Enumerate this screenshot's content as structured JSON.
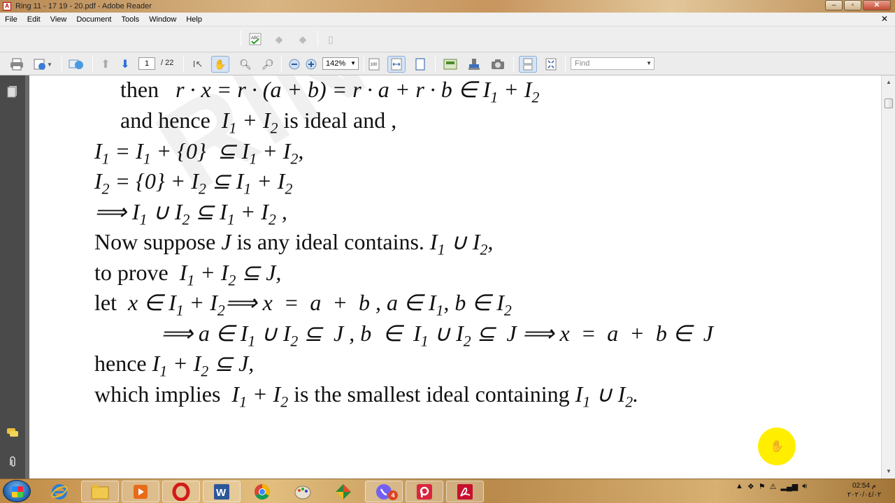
{
  "window": {
    "title": "Ring  11 - 17   19 - 20.pdf - Adobe Reader",
    "controls": [
      "–",
      "▫",
      "✕"
    ]
  },
  "menu": [
    "File",
    "Edit",
    "View",
    "Document",
    "Tools",
    "Window",
    "Help"
  ],
  "menu_close": "✕",
  "toolbar": {
    "page_current": "1",
    "page_total": "/ 22",
    "zoom": "142%",
    "find_placeholder": "Find"
  },
  "document": {
    "watermark": "RING",
    "lines": [
      {
        "parts": [
          [
            "t",
            "then   "
          ],
          [
            "m",
            "r · x = r · (a + b) = r · a + r · b ∈ I"
          ],
          [
            "s",
            "1"
          ],
          [
            "m",
            " + I"
          ],
          [
            "s",
            "2"
          ]
        ]
      },
      {
        "parts": [
          [
            "t",
            "and hence  "
          ],
          [
            "m",
            "I"
          ],
          [
            "s",
            "1"
          ],
          [
            "m",
            " + I"
          ],
          [
            "s",
            "2"
          ],
          [
            "t",
            " is ideal and ,"
          ]
        ]
      },
      {
        "parts": [
          [
            "m",
            "I"
          ],
          [
            "s",
            "1"
          ],
          [
            "m",
            " = I"
          ],
          [
            "s",
            "1"
          ],
          [
            "m",
            " + {0}  ⊆ I"
          ],
          [
            "s",
            "1"
          ],
          [
            "m",
            " + I"
          ],
          [
            "s",
            "2"
          ],
          [
            "m",
            ","
          ]
        ]
      },
      {
        "parts": [
          [
            "m",
            "I"
          ],
          [
            "s",
            "2"
          ],
          [
            "m",
            " = {0} + I"
          ],
          [
            "s",
            "2"
          ],
          [
            "m",
            " ⊆ I"
          ],
          [
            "s",
            "1"
          ],
          [
            "m",
            " + I"
          ],
          [
            "s",
            "2"
          ]
        ]
      },
      {
        "parts": [
          [
            "m",
            "⟹ I"
          ],
          [
            "s",
            "1"
          ],
          [
            "m",
            " ∪ I"
          ],
          [
            "s",
            "2"
          ],
          [
            "m",
            " ⊆ I"
          ],
          [
            "s",
            "1"
          ],
          [
            "m",
            " + I"
          ],
          [
            "s",
            "2"
          ],
          [
            "m",
            " ,"
          ]
        ]
      },
      {
        "parts": [
          [
            "t",
            "Now suppose "
          ],
          [
            "m",
            "J"
          ],
          [
            "t",
            " is any ideal contains. "
          ],
          [
            "m",
            "I"
          ],
          [
            "s",
            "1"
          ],
          [
            "m",
            " ∪ I"
          ],
          [
            "s",
            "2"
          ],
          [
            "m",
            ","
          ]
        ]
      },
      {
        "parts": [
          [
            "t",
            "to prove  "
          ],
          [
            "m",
            "I"
          ],
          [
            "s",
            "1"
          ],
          [
            "m",
            " + I"
          ],
          [
            "s",
            "2"
          ],
          [
            "m",
            " ⊆ J,"
          ]
        ]
      },
      {
        "parts": [
          [
            "t",
            "let  "
          ],
          [
            "m",
            "x ∈ I"
          ],
          [
            "s",
            "1"
          ],
          [
            "m",
            " + I"
          ],
          [
            "s",
            "2"
          ],
          [
            "m",
            "⟹ x  =  a  +  b , a ∈ I"
          ],
          [
            "s",
            "1"
          ],
          [
            "m",
            ", b ∈ I"
          ],
          [
            "s",
            "2"
          ]
        ]
      },
      {
        "parts": [
          [
            "m",
            "⟹ a ∈ I"
          ],
          [
            "s",
            "1"
          ],
          [
            "m",
            " ∪ I"
          ],
          [
            "s",
            "2"
          ],
          [
            "m",
            " ⊆  J , b  ∈  I"
          ],
          [
            "s",
            "1"
          ],
          [
            "m",
            " ∪ I"
          ],
          [
            "s",
            "2"
          ],
          [
            "m",
            " ⊆  J ⟹ x  =  a  +  b ∈  J"
          ]
        ]
      },
      {
        "parts": [
          [
            "t",
            "hence "
          ],
          [
            "m",
            "I"
          ],
          [
            "s",
            "1"
          ],
          [
            "m",
            " + I"
          ],
          [
            "s",
            "2"
          ],
          [
            "m",
            " ⊆ J,"
          ]
        ]
      },
      {
        "parts": [
          [
            "t",
            "which implies  "
          ],
          [
            "m",
            "I"
          ],
          [
            "s",
            "1"
          ],
          [
            "m",
            " + I"
          ],
          [
            "s",
            "2"
          ],
          [
            "t",
            " is the smallest ideal containing "
          ],
          [
            "m",
            "I"
          ],
          [
            "s",
            "1"
          ],
          [
            "m",
            " ∪ I"
          ],
          [
            "s",
            "2"
          ],
          [
            "m",
            "."
          ]
        ]
      }
    ]
  },
  "taskbar": {
    "apps": [
      "start-orb",
      "internet-explorer",
      "file-explorer",
      "media-player",
      "opera",
      "word",
      "chrome",
      "paint",
      "photo-app",
      "viber",
      "pdf-tool",
      "adobe-reader"
    ],
    "viber_badge": "4",
    "clock_time": "02:54 م",
    "clock_date": "٢٠٢٠/٠٤/٠٢"
  }
}
